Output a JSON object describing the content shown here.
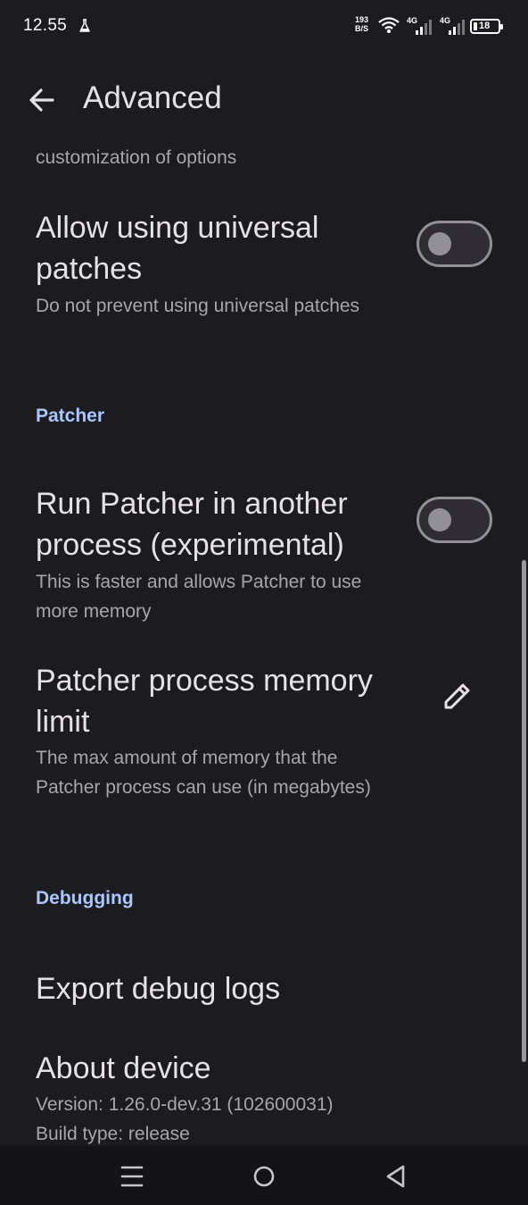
{
  "status_bar": {
    "time": "12.55",
    "net_rate_value": "193",
    "net_rate_unit": "B/S",
    "sim1_label": "4G",
    "sim2_label": "4G",
    "battery_level": "18"
  },
  "app_bar": {
    "title": "Advanced",
    "back_icon": "arrow-left-icon"
  },
  "preferences": {
    "previous_summary_tail": "customization of options",
    "universal_patches": {
      "title": "Allow using universal patches",
      "summary": "Do not prevent using universal patches",
      "checked": false
    },
    "patcher_category": "Patcher",
    "run_patcher": {
      "title": "Run Patcher in another process (experimental)",
      "summary": "This is faster and allows Patcher to use more memory",
      "checked": false
    },
    "memory_limit": {
      "title": "Patcher process memory limit",
      "summary": "The max amount of memory that the Patcher process can use (in megabytes)",
      "icon": "pencil-edit-icon"
    },
    "debugging_category": "Debugging",
    "export_logs": {
      "title": "Export debug logs"
    },
    "about_device": {
      "title": "About device",
      "version": "Version: 1.26.0-dev.31 (102600031)",
      "build_type": "Build type: release"
    }
  },
  "nav_bar": {
    "recents_icon": "menu-lines-icon",
    "home_icon": "circle-home-icon",
    "back_icon": "triangle-back-icon"
  },
  "colors": {
    "background": "#1c1b1f",
    "category_accent": "#a9c7ff",
    "switch_outline": "#938f99"
  }
}
